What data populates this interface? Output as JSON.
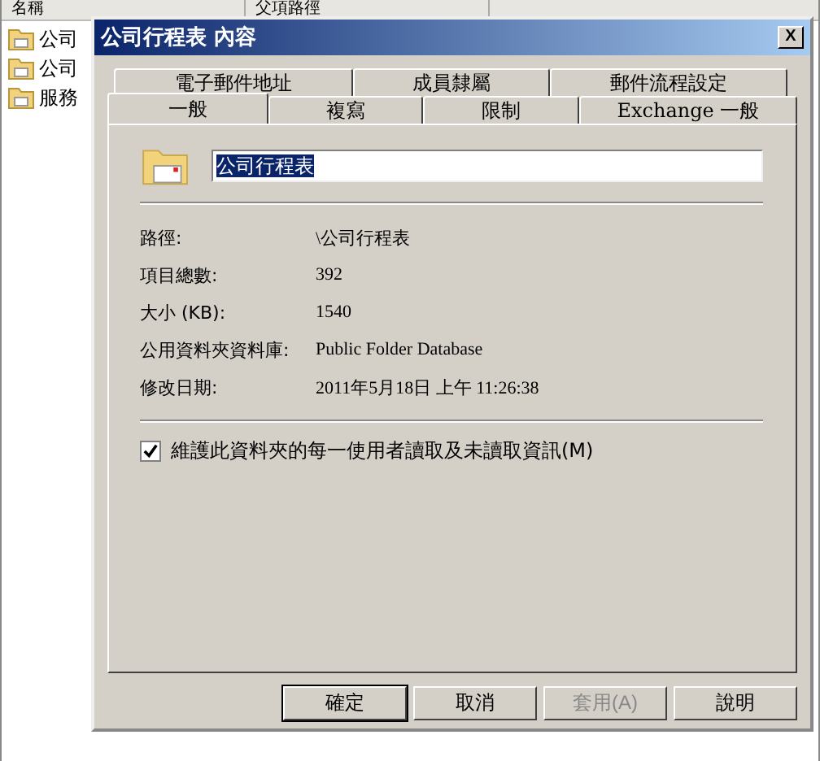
{
  "background_list": {
    "columns": [
      "名稱",
      "父項路徑"
    ],
    "rows": [
      {
        "name": "公司"
      },
      {
        "name": "公司"
      },
      {
        "name": "服務"
      }
    ]
  },
  "dialog": {
    "title": "公司行程表 內容",
    "close": "X",
    "tab_rows": [
      [
        {
          "label": "電子郵件地址",
          "selected": false
        },
        {
          "label": "成員隸屬",
          "selected": false
        },
        {
          "label": "郵件流程設定",
          "selected": false
        }
      ],
      [
        {
          "label": "一般",
          "selected": true
        },
        {
          "label": "複寫",
          "selected": false
        },
        {
          "label": "限制",
          "selected": false
        },
        {
          "label": "Exchange 一般",
          "selected": false
        }
      ]
    ],
    "name_field": {
      "value": "公司行程表"
    },
    "properties": [
      {
        "label": "路徑:",
        "value": "\\公司行程表"
      },
      {
        "label": "項目總數:",
        "value": "392"
      },
      {
        "label": "大小 (KB):",
        "value": "1540"
      },
      {
        "label": "公用資料夾資料庫:",
        "value": "Public Folder Database"
      },
      {
        "label": "修改日期:",
        "value": "2011年5月18日 上午 11:26:38"
      }
    ],
    "checkbox": {
      "label": "維護此資料夾的每一使用者讀取及未讀取資訊(M)",
      "checked": true
    },
    "buttons": [
      {
        "label": "確定",
        "default": true,
        "disabled": false
      },
      {
        "label": "取消",
        "default": false,
        "disabled": false
      },
      {
        "label": "套用(A)",
        "default": false,
        "disabled": true
      },
      {
        "label": "說明",
        "default": false,
        "disabled": false
      }
    ]
  }
}
